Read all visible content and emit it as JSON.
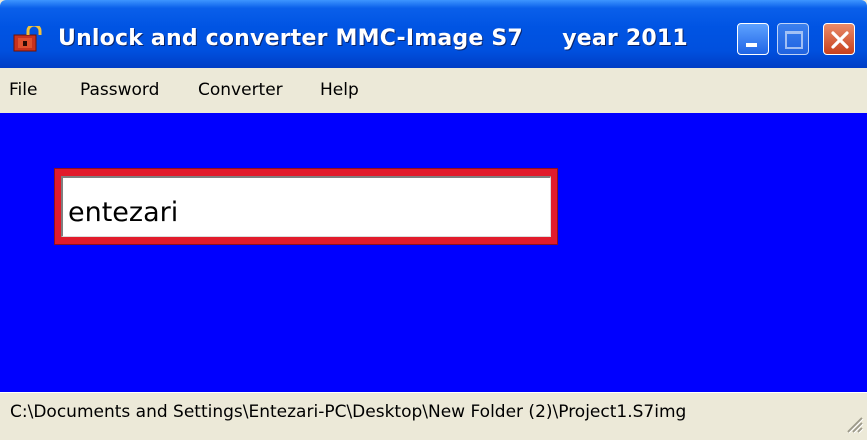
{
  "window": {
    "title": "Unlock and converter MMC-Image S7     year 2011"
  },
  "menu": {
    "items": [
      "File",
      "Password",
      "Converter",
      "Help"
    ]
  },
  "password_input": {
    "value": "entezari"
  },
  "statusbar": {
    "path": "C:\\Documents and Settings\\Entezari-PC\\Desktop\\New Folder (2)\\Project1.S7img"
  },
  "colors": {
    "client_background": "#0000ff",
    "input_frame": "#e11b2b",
    "titlebar": "#0054e3"
  },
  "icons": [
    "padlock-icon",
    "minimize-icon",
    "maximize-icon",
    "close-icon",
    "resize-grip-icon"
  ]
}
